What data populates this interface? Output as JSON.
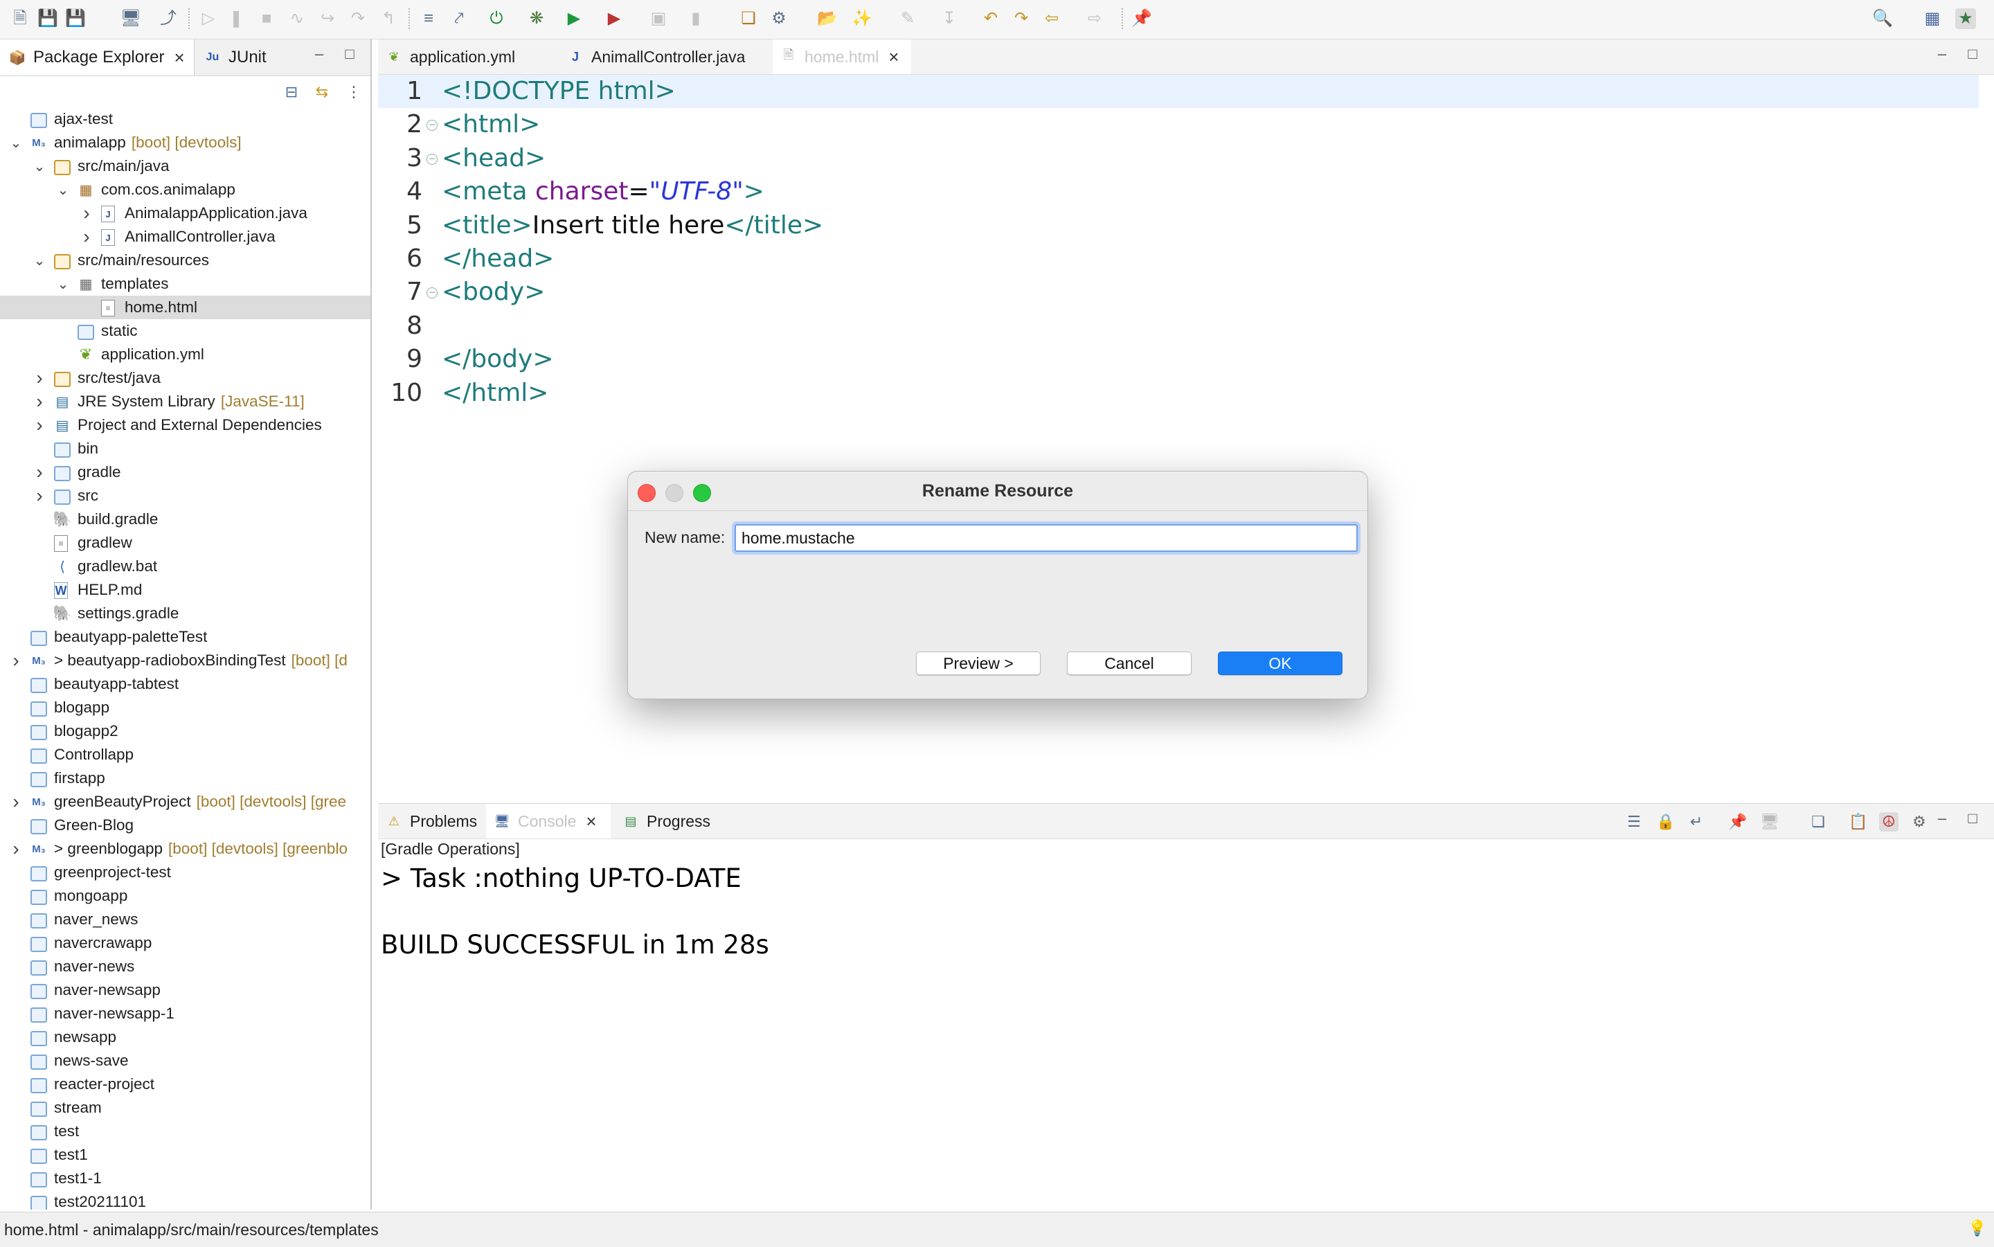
{
  "left_panel": {
    "tabs": [
      {
        "label": "Package Explorer",
        "icon": "package-explorer-icon"
      },
      {
        "label": "JUnit",
        "icon": "junit-icon"
      }
    ],
    "tree": [
      {
        "label": "ajax-test",
        "deco": "",
        "indent": 0,
        "expander": "",
        "icon": "folder"
      },
      {
        "label": "animalapp",
        "deco": "[boot] [devtools]",
        "indent": 0,
        "expander": "open",
        "icon": "boot"
      },
      {
        "label": "src/main/java",
        "deco": "",
        "indent": 1,
        "expander": "open",
        "icon": "pkgf"
      },
      {
        "label": "com.cos.animalapp",
        "deco": "",
        "indent": 2,
        "expander": "open",
        "icon": "pkg"
      },
      {
        "label": "AnimalappApplication.java",
        "deco": "",
        "indent": 3,
        "expander": "closed",
        "icon": "java"
      },
      {
        "label": "AnimallController.java",
        "deco": "",
        "indent": 3,
        "expander": "closed",
        "icon": "java"
      },
      {
        "label": "src/main/resources",
        "deco": "",
        "indent": 1,
        "expander": "open",
        "icon": "pkgf"
      },
      {
        "label": "templates",
        "deco": "",
        "indent": 2,
        "expander": "open",
        "icon": "tpl"
      },
      {
        "label": "home.html",
        "deco": "",
        "indent": 3,
        "expander": "",
        "icon": "html",
        "selected": true
      },
      {
        "label": "static",
        "deco": "",
        "indent": 2,
        "expander": "",
        "icon": "folder"
      },
      {
        "label": "application.yml",
        "deco": "",
        "indent": 2,
        "expander": "",
        "icon": "yml"
      },
      {
        "label": "src/test/java",
        "deco": "",
        "indent": 1,
        "expander": "closed",
        "icon": "pkgf"
      },
      {
        "label": "JRE System Library",
        "deco": "[JavaSE-11]",
        "indent": 1,
        "expander": "closed",
        "icon": "lib"
      },
      {
        "label": "Project and External Dependencies",
        "deco": "",
        "indent": 1,
        "expander": "closed",
        "icon": "lib"
      },
      {
        "label": "bin",
        "deco": "",
        "indent": 1,
        "expander": "",
        "icon": "folder"
      },
      {
        "label": "gradle",
        "deco": "",
        "indent": 1,
        "expander": "closed",
        "icon": "folder"
      },
      {
        "label": "src",
        "deco": "",
        "indent": 1,
        "expander": "closed",
        "icon": "folder"
      },
      {
        "label": "build.gradle",
        "deco": "",
        "indent": 1,
        "expander": "",
        "icon": "gradle"
      },
      {
        "label": "gradlew",
        "deco": "",
        "indent": 1,
        "expander": "",
        "icon": "html"
      },
      {
        "label": "gradlew.bat",
        "deco": "",
        "indent": 1,
        "expander": "",
        "icon": "bat"
      },
      {
        "label": "HELP.md",
        "deco": "",
        "indent": 1,
        "expander": "",
        "icon": "word"
      },
      {
        "label": "settings.gradle",
        "deco": "",
        "indent": 1,
        "expander": "",
        "icon": "gradle"
      },
      {
        "label": "beautyapp-paletteTest",
        "deco": "",
        "indent": 0,
        "expander": "",
        "icon": "folder"
      },
      {
        "label": "> beautyapp-radioboxBindingTest",
        "deco": "[boot] [d",
        "indent": 0,
        "expander": "closed",
        "icon": "boot"
      },
      {
        "label": "beautyapp-tabtest",
        "deco": "",
        "indent": 0,
        "expander": "",
        "icon": "folder"
      },
      {
        "label": "blogapp",
        "deco": "",
        "indent": 0,
        "expander": "",
        "icon": "folder"
      },
      {
        "label": "blogapp2",
        "deco": "",
        "indent": 0,
        "expander": "",
        "icon": "folder"
      },
      {
        "label": "Controllapp",
        "deco": "",
        "indent": 0,
        "expander": "",
        "icon": "folder"
      },
      {
        "label": "firstapp",
        "deco": "",
        "indent": 0,
        "expander": "",
        "icon": "folder"
      },
      {
        "label": "greenBeautyProject",
        "deco": "[boot] [devtools] [gree",
        "indent": 0,
        "expander": "closed",
        "icon": "boot"
      },
      {
        "label": "Green-Blog",
        "deco": "",
        "indent": 0,
        "expander": "",
        "icon": "folder"
      },
      {
        "label": "> greenblogapp",
        "deco": "[boot] [devtools] [greenblo",
        "indent": 0,
        "expander": "closed",
        "icon": "boot"
      },
      {
        "label": "greenproject-test",
        "deco": "",
        "indent": 0,
        "expander": "",
        "icon": "folder"
      },
      {
        "label": "mongoapp",
        "deco": "",
        "indent": 0,
        "expander": "",
        "icon": "folder"
      },
      {
        "label": "naver_news",
        "deco": "",
        "indent": 0,
        "expander": "",
        "icon": "folder"
      },
      {
        "label": "navercrawapp",
        "deco": "",
        "indent": 0,
        "expander": "",
        "icon": "folder"
      },
      {
        "label": "naver-news",
        "deco": "",
        "indent": 0,
        "expander": "",
        "icon": "folder"
      },
      {
        "label": "naver-newsapp",
        "deco": "",
        "indent": 0,
        "expander": "",
        "icon": "folder"
      },
      {
        "label": "naver-newsapp-1",
        "deco": "",
        "indent": 0,
        "expander": "",
        "icon": "folder"
      },
      {
        "label": "newsapp",
        "deco": "",
        "indent": 0,
        "expander": "",
        "icon": "folder"
      },
      {
        "label": "news-save",
        "deco": "",
        "indent": 0,
        "expander": "",
        "icon": "folder"
      },
      {
        "label": "reacter-project",
        "deco": "",
        "indent": 0,
        "expander": "",
        "icon": "folder"
      },
      {
        "label": "stream",
        "deco": "",
        "indent": 0,
        "expander": "",
        "icon": "folder"
      },
      {
        "label": "test",
        "deco": "",
        "indent": 0,
        "expander": "",
        "icon": "folder"
      },
      {
        "label": "test1",
        "deco": "",
        "indent": 0,
        "expander": "",
        "icon": "folder"
      },
      {
        "label": "test1-1",
        "deco": "",
        "indent": 0,
        "expander": "",
        "icon": "folder"
      },
      {
        "label": "test20211101",
        "deco": "",
        "indent": 0,
        "expander": "",
        "icon": "folder"
      }
    ]
  },
  "editor": {
    "tabs": [
      {
        "label": "application.yml",
        "icon": "yml-file-icon",
        "active": false
      },
      {
        "label": "AnimallController.java",
        "icon": "java-file-icon",
        "active": false
      },
      {
        "label": "home.html",
        "icon": "html-file-icon",
        "active": true
      }
    ],
    "lines": [
      {
        "num": "1",
        "parts": [
          [
            "tag",
            "<!DOCTYPE html>"
          ]
        ],
        "fold": false,
        "highlight": true
      },
      {
        "num": "2",
        "parts": [
          [
            "tag",
            "<html>"
          ]
        ],
        "fold": true
      },
      {
        "num": "3",
        "parts": [
          [
            "tag",
            "<head>"
          ]
        ],
        "fold": true
      },
      {
        "num": "4",
        "parts": [
          [
            "tag",
            "<meta "
          ],
          [
            "attr",
            "charset"
          ],
          [
            "plain",
            "="
          ],
          [
            "str",
            "\"UTF-8\""
          ],
          [
            "tag",
            ">"
          ]
        ],
        "fold": false
      },
      {
        "num": "5",
        "parts": [
          [
            "tag",
            "<title>"
          ],
          [
            "plain",
            "Insert title here"
          ],
          [
            "tag",
            "</title>"
          ]
        ],
        "fold": false
      },
      {
        "num": "6",
        "parts": [
          [
            "tag",
            "</head>"
          ]
        ],
        "fold": false
      },
      {
        "num": "7",
        "parts": [
          [
            "tag",
            "<body>"
          ]
        ],
        "fold": true
      },
      {
        "num": "8",
        "parts": [],
        "fold": false
      },
      {
        "num": "9",
        "parts": [
          [
            "tag",
            "</body>"
          ]
        ],
        "fold": false
      },
      {
        "num": "10",
        "parts": [
          [
            "tag",
            "</html>"
          ]
        ],
        "fold": false
      }
    ]
  },
  "bottom_panel": {
    "tabs": [
      {
        "label": "Problems",
        "icon": "problems-icon",
        "active": false
      },
      {
        "label": "Console",
        "icon": "console-icon",
        "active": true
      },
      {
        "label": "Progress",
        "icon": "progress-icon",
        "active": false
      }
    ],
    "console_header": "[Gradle Operations]",
    "output": [
      "> Task :nothing UP-TO-DATE",
      "",
      "BUILD SUCCESSFUL in 1m 28s"
    ]
  },
  "status_bar": {
    "text": "home.html - animalapp/src/main/resources/templates"
  },
  "dialog": {
    "title": "Rename Resource",
    "new_name_label": "New name:",
    "new_name_value": "home.mustache",
    "preview_label": "Preview >",
    "cancel_label": "Cancel",
    "ok_label": "OK"
  },
  "colors": {
    "tag": "#1e7b7b",
    "attr": "#7a1a8e",
    "string": "#2a36d8",
    "deco": "#a07d2e",
    "ok_button": "#1a7ff5",
    "selection": "#dcdcdc"
  }
}
